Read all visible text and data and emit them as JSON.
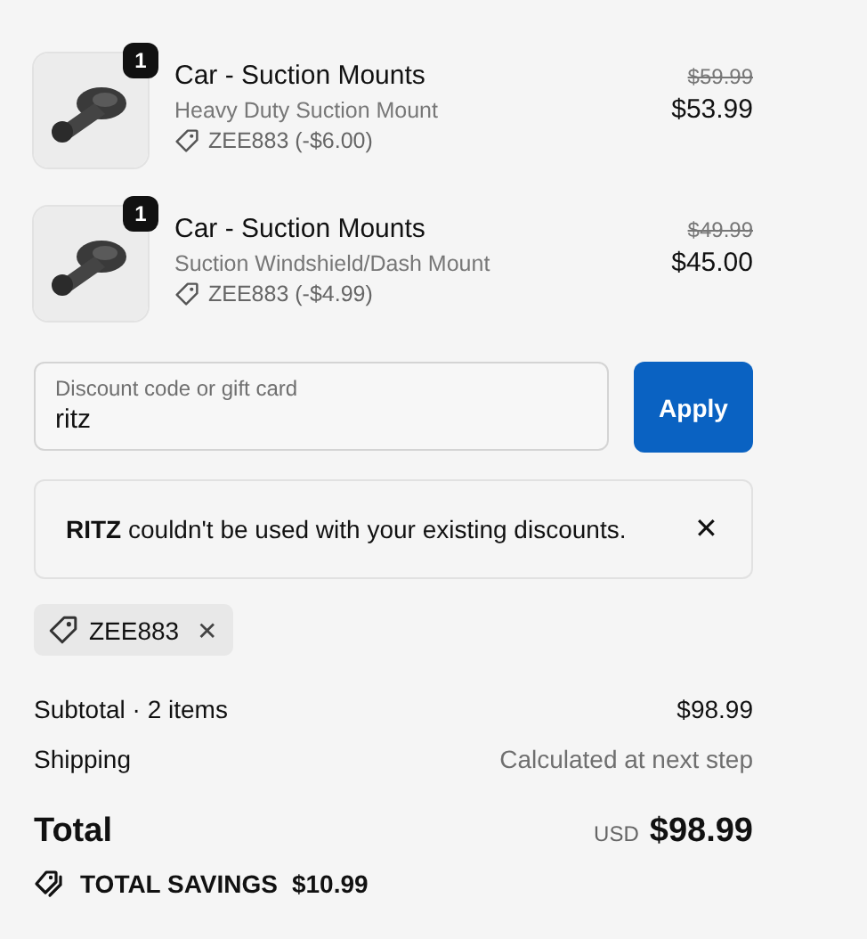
{
  "line_items": [
    {
      "quantity": "1",
      "title": "Car - Suction Mounts",
      "variant": "Heavy Duty Suction Mount",
      "discount": "ZEE883 (-$6.00)",
      "original_price": "$59.99",
      "price": "$53.99"
    },
    {
      "quantity": "1",
      "title": "Car - Suction Mounts",
      "variant": "Suction Windshield/Dash Mount",
      "discount": "ZEE883 (-$4.99)",
      "original_price": "$49.99",
      "price": "$45.00"
    }
  ],
  "discount_field": {
    "placeholder": "Discount code or gift card",
    "value": "ritz"
  },
  "apply_button": "Apply",
  "error": {
    "message": "**RITZ** couldn't be used with your existing discounts.",
    "close": "✕"
  },
  "applied_codes": [
    {
      "code": "ZEE883",
      "remove": "✕"
    }
  ],
  "summary": [
    {
      "label": "Subtotal · 2 items",
      "value": "$98.99",
      "kind": "plain"
    },
    {
      "label": "Shipping",
      "value": "Calculated at next step",
      "kind": "muted"
    }
  ],
  "total": {
    "label": "Total",
    "currency": "USD",
    "amount": "$98.99"
  },
  "savings": {
    "label": "TOTAL SAVINGS",
    "amount": "$10.99"
  }
}
